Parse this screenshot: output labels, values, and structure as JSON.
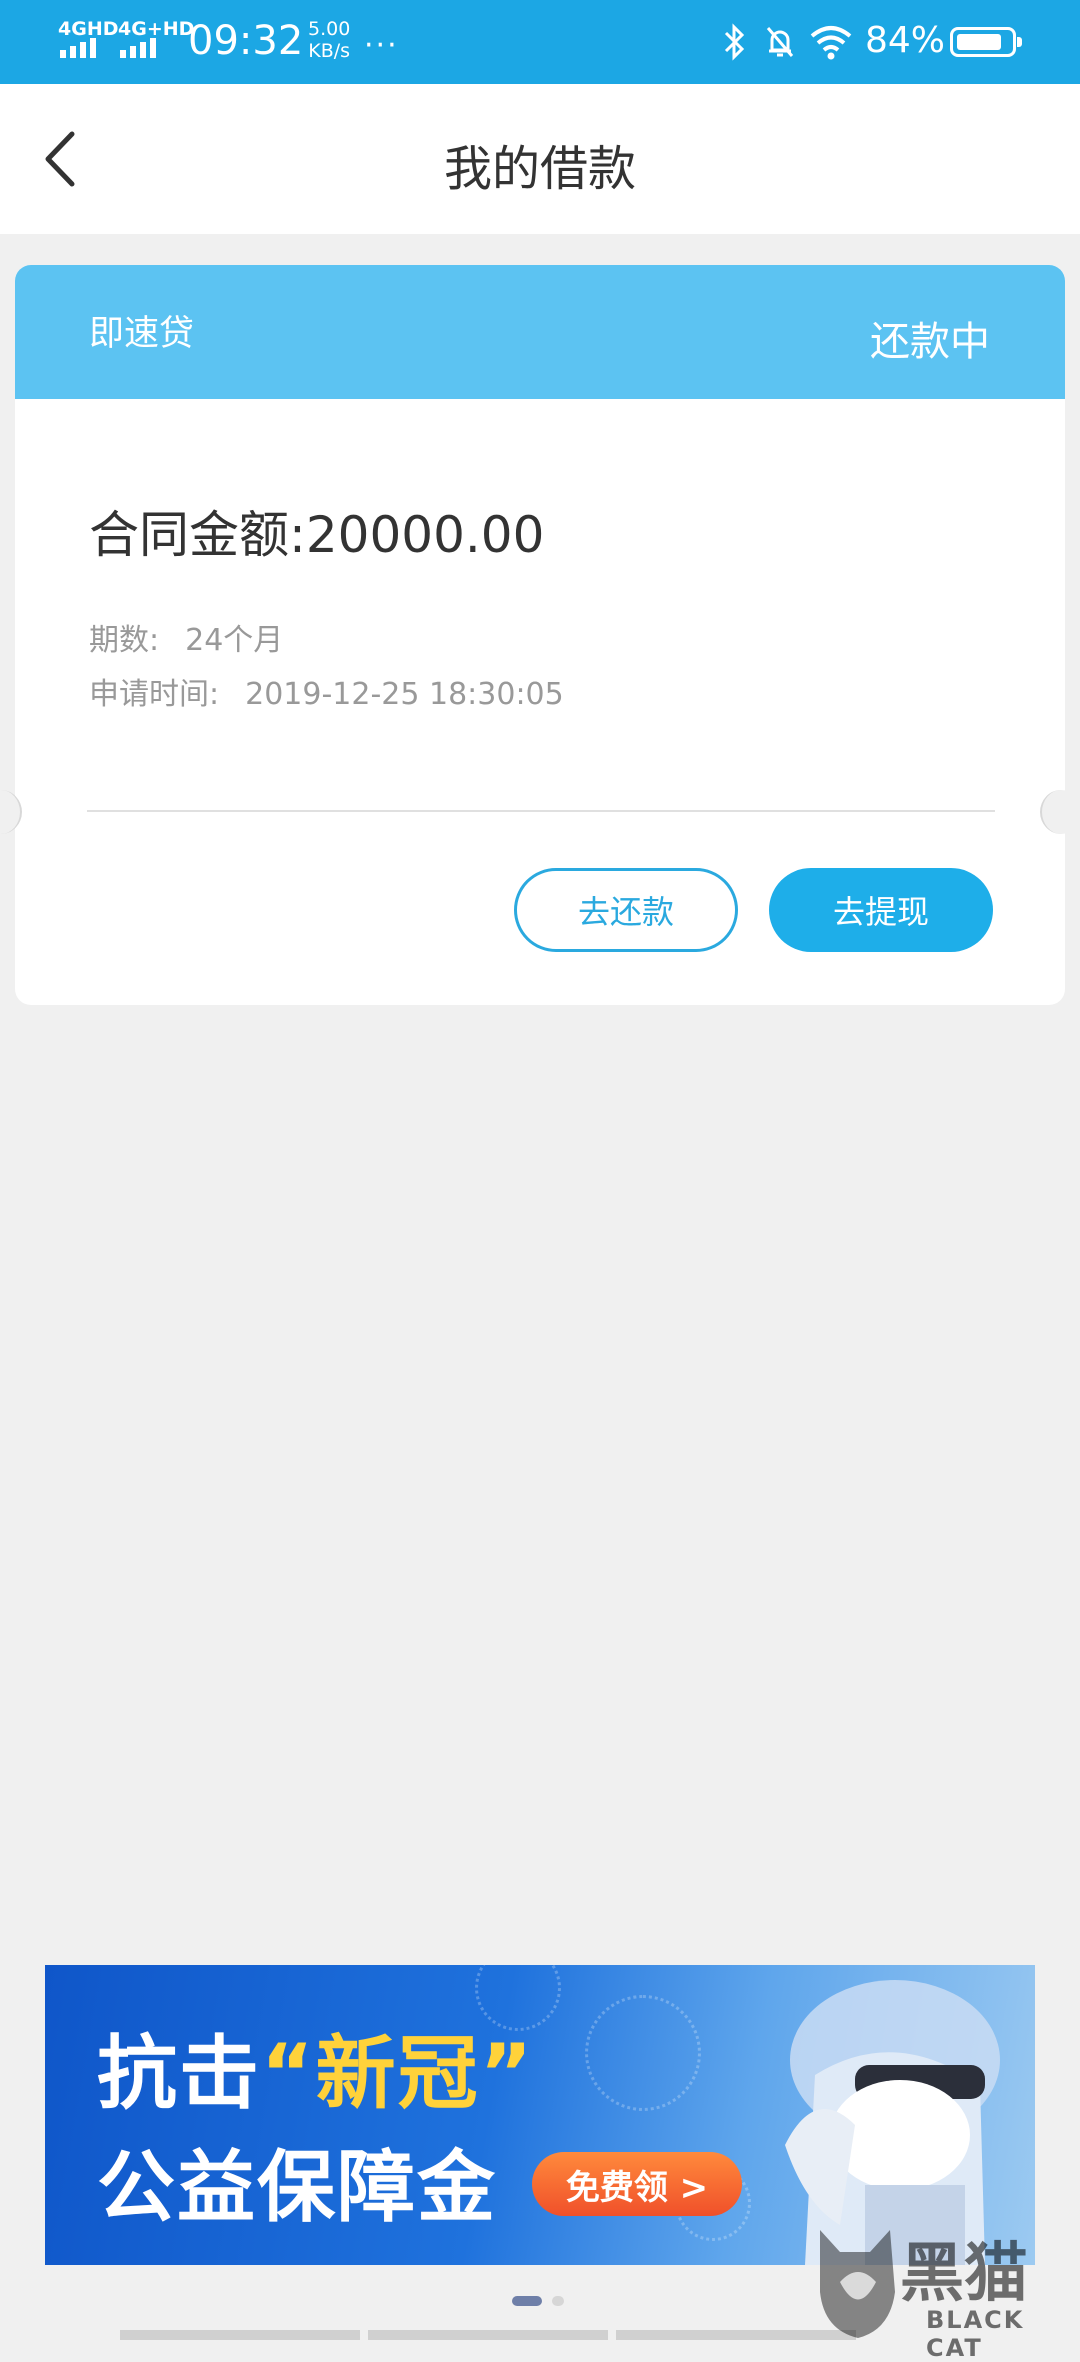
{
  "status_bar": {
    "network1": "4GHD",
    "network2": "4G+HD",
    "time": "09:32",
    "speed_value": "5.00",
    "speed_unit": "KB/s",
    "more": "···",
    "battery": "84%",
    "battery_level": 0.84
  },
  "nav": {
    "title": "我的借款"
  },
  "loan_card": {
    "product_name": "即速贷",
    "status": "还款中",
    "amount_label": "合同金额:",
    "amount_value": "20000.00",
    "periods_label": "期数:",
    "periods_value": "24个月",
    "apply_time_label": "申请时间:",
    "apply_time_value": "2019-12-25 18:30:05",
    "repay_button": "去还款",
    "withdraw_button": "去提现"
  },
  "banner": {
    "line1_pre": "抗击",
    "line1_highlight": "“新冠”",
    "line2": "公益保障金",
    "cta": "免费领 >"
  },
  "carousel": {
    "pages": 2,
    "active": 1
  },
  "watermark": {
    "text": "黑猫",
    "sub": "BLACK CAT"
  },
  "colors": {
    "status_bar": "#1ca7e4",
    "card_header": "#5cc3f2",
    "primary_button": "#1eaee9",
    "page_background": "#f0f0f0"
  }
}
